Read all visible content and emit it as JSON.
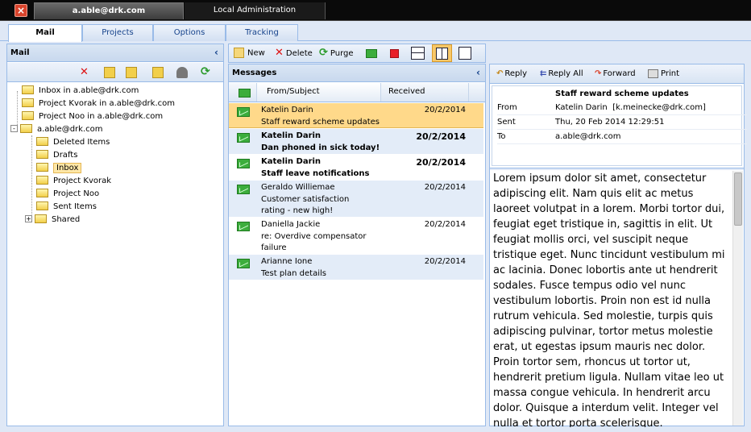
{
  "window": {
    "user_tab": "a.able@drk.com",
    "admin_tab": "Local Administration"
  },
  "tabs": [
    "Mail",
    "Projects",
    "Options",
    "Tracking"
  ],
  "mail_panel": {
    "title": "Mail",
    "collapse": "‹",
    "tree": [
      "Inbox in a.able@drk.com",
      "Project Kvorak in a.able@drk.com",
      "Project Noo in a.able@drk.com",
      "a.able@drk.com",
      "Deleted Items",
      "Drafts",
      "Inbox",
      "Project Kvorak",
      "Project Noo",
      "Sent Items",
      "Shared"
    ],
    "expanders": [
      "-",
      "+"
    ]
  },
  "toolbar": {
    "new": "New",
    "delete": "Delete",
    "purge": "Purge"
  },
  "messages": {
    "title": "Messages",
    "collapse": "‹",
    "col_from": "From/Subject",
    "col_received": "Received",
    "items": [
      {
        "from": "Katelin Darin",
        "subject": "Staff reward scheme updates",
        "date": "20/2/2014"
      },
      {
        "from": "Katelin Darin",
        "subject": "Dan phoned in sick today!",
        "date": "20/2/2014"
      },
      {
        "from": "Katelin Darin",
        "subject": "Staff leave notifications",
        "date": "20/2/2014"
      },
      {
        "from": "Geraldo Williemae",
        "subject": "Customer satisfaction rating - new high!",
        "date": "20/2/2014"
      },
      {
        "from": "Daniella Jackie",
        "subject": "re: Overdive compensator failure",
        "date": "20/2/2014"
      },
      {
        "from": "Arianne Ione",
        "subject": "Test plan details",
        "date": "20/2/2014"
      }
    ]
  },
  "preview": {
    "reply": "Reply",
    "reply_all": "Reply All",
    "forward": "Forward",
    "print": "Print",
    "subject": "Staff reward scheme updates",
    "from_label": "From",
    "from_value": "Katelin Darin  [k.meinecke@drk.com]",
    "sent_label": "Sent",
    "sent_value": "Thu, 20 Feb 2014 12:29:51",
    "to_label": "To",
    "to_value": "a.able@drk.com",
    "body": "Lorem ipsum dolor sit amet, consectetur adipiscing elit. Nam quis elit ac metus laoreet volutpat in a lorem. Morbi tortor dui, feugiat eget tristique in, sagittis in elit. Ut feugiat mollis orci, vel suscipit neque tristique eget. Nunc tincidunt vestibulum mi ac lacinia. Donec lobortis ante ut hendrerit sodales. Fusce tempus odio vel nunc vestibulum lobortis. Proin non est id nulla rutrum vehicula. Sed molestie, turpis quis adipiscing pulvinar, tortor metus molestie erat, ut egestas ipsum mauris nec dolor. Proin tortor sem, rhoncus ut tortor ut, hendrerit pretium ligula. Nullam vitae leo ut massa congue vehicula. In hendrerit arcu dolor. Quisque a interdum velit. Integer vel nulla et tortor porta scelerisque."
  },
  "colors": {
    "accent": "#99bbe8",
    "selected_row": "#ffd98a",
    "unread_row": "#e3ecf8"
  }
}
